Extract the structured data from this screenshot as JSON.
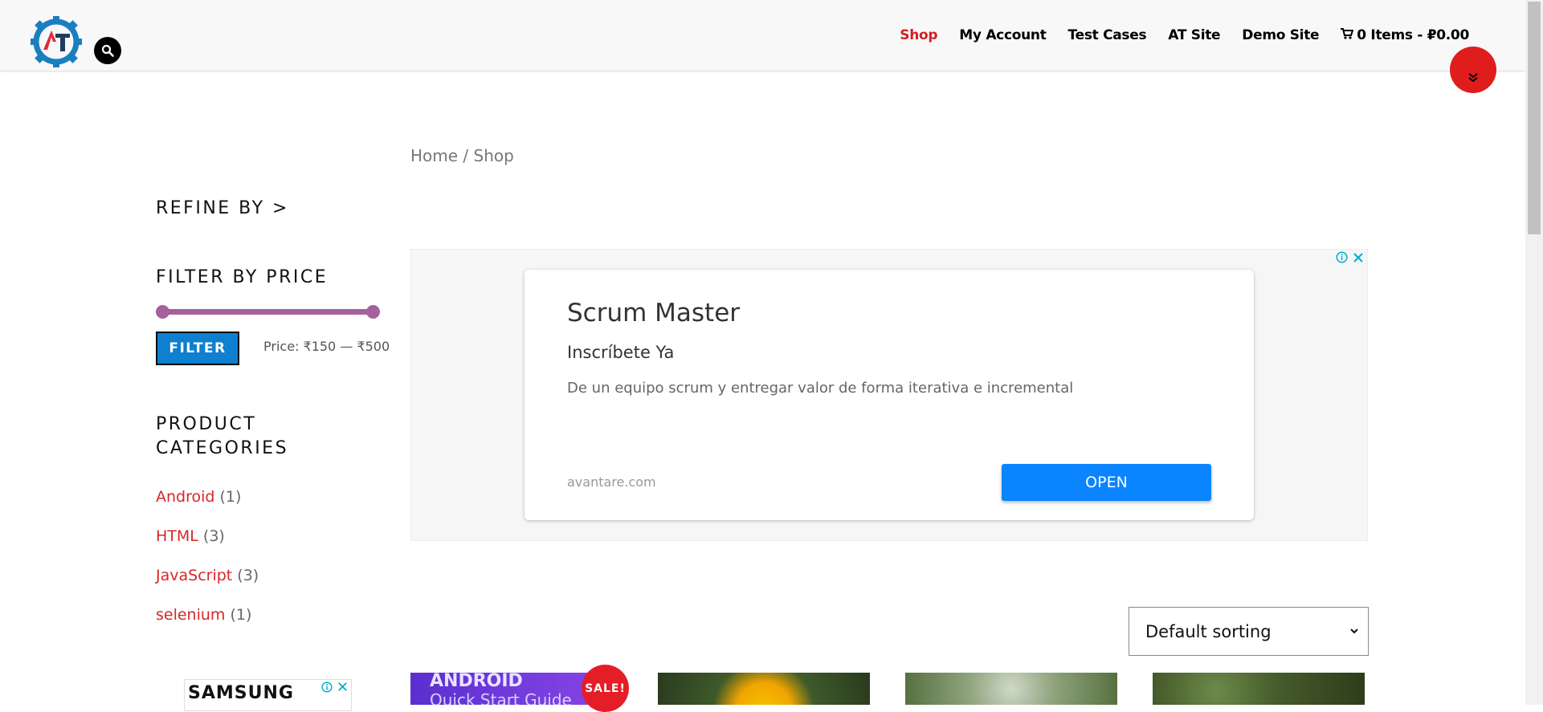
{
  "nav": {
    "items": [
      {
        "label": "Shop",
        "active": true
      },
      {
        "label": "My Account",
        "active": false
      },
      {
        "label": "Test Cases",
        "active": false
      },
      {
        "label": "AT Site",
        "active": false
      },
      {
        "label": "Demo Site",
        "active": false
      }
    ],
    "cart_label": "0 Items - ₽0.00"
  },
  "breadcrumb": "Home / Shop",
  "sidebar": {
    "refine_title": "REFINE BY >",
    "price_title": "FILTER BY PRICE",
    "filter_button": "FILTER",
    "price_range_text": "Price: ₹150 — ₹500",
    "categories_title_line1": "PRODUCT",
    "categories_title_line2": "CATEGORIES",
    "categories": [
      {
        "name": "Android",
        "count": "(1)"
      },
      {
        "name": "HTML",
        "count": "(3)"
      },
      {
        "name": "JavaScript",
        "count": "(3)"
      },
      {
        "name": "selenium",
        "count": "(1)"
      }
    ]
  },
  "ad": {
    "title": "Scrum Master",
    "subtitle": "Inscríbete Ya",
    "description": "De un equipo scrum y entregar valor de forma iterativa e incremental",
    "domain": "avantare.com",
    "cta": "OPEN"
  },
  "sorting": {
    "selected": "Default sorting"
  },
  "products": {
    "p1_text_line1": "ANDROID",
    "p1_text_line2": "Quick Start Guide",
    "sale_badge": "SALE!"
  },
  "bottom_ad": {
    "brand": "SAMSUNG"
  },
  "colors": {
    "accent_red": "#d7262a",
    "filter_blue": "#0f7fcf",
    "slider_purple": "#a6619c",
    "ad_button_blue": "#0a84ff"
  }
}
